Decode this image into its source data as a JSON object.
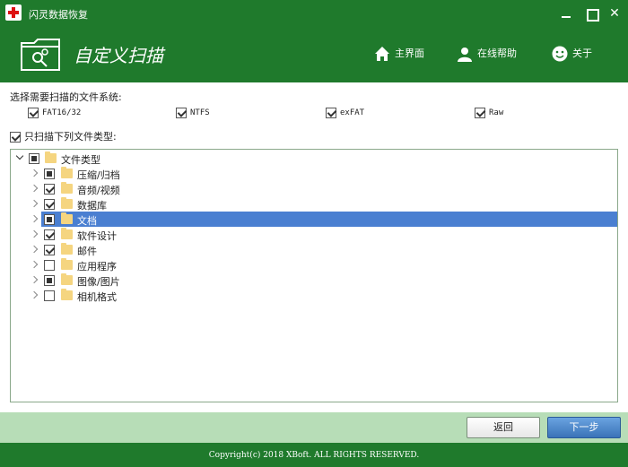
{
  "window": {
    "title": "闪灵数据恢复"
  },
  "header": {
    "title": "自定义扫描",
    "nav": [
      {
        "label": "主界面",
        "icon": "home-icon"
      },
      {
        "label": "在线帮助",
        "icon": "user-help-icon"
      },
      {
        "label": "关于",
        "icon": "smiley-icon"
      }
    ]
  },
  "filesystems": {
    "label": "选择需要扫描的文件系统:",
    "items": [
      {
        "label": "FAT16/32",
        "checked": true
      },
      {
        "label": "NTFS",
        "checked": true
      },
      {
        "label": "exFAT",
        "checked": true
      },
      {
        "label": "Raw",
        "checked": true
      }
    ]
  },
  "only_scan": {
    "label": "只扫描下列文件类型:",
    "checked": true
  },
  "tree": {
    "root": {
      "label": "文件类型",
      "state": "partial",
      "expanded": true
    },
    "items": [
      {
        "label": "压缩/归档",
        "state": "partial"
      },
      {
        "label": "音频/视频",
        "state": "checked"
      },
      {
        "label": "数据库",
        "state": "checked"
      },
      {
        "label": "文档",
        "state": "partial",
        "selected": true
      },
      {
        "label": "软件设计",
        "state": "checked"
      },
      {
        "label": "邮件",
        "state": "checked"
      },
      {
        "label": "应用程序",
        "state": "unchecked"
      },
      {
        "label": "图像/图片",
        "state": "partial"
      },
      {
        "label": "相机格式",
        "state": "unchecked"
      }
    ]
  },
  "buttons": {
    "back": "返回",
    "next": "下一步"
  },
  "footer": {
    "copyright": "Copyright(c) 2018 XBoft. ALL RIGHTS RESERVED."
  },
  "colors": {
    "brand_green": "#1f7a2c",
    "footer_band": "#b7ddb7",
    "selection": "#4a7fd1"
  }
}
